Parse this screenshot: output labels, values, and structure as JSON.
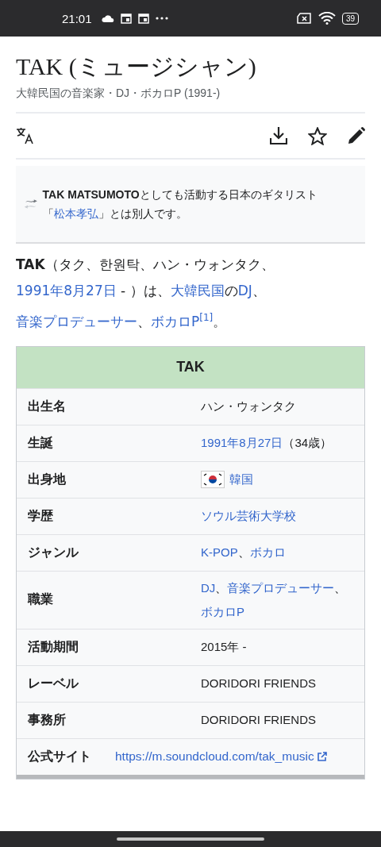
{
  "status_bar": {
    "time": "21:01",
    "battery": "39"
  },
  "header": {
    "title": "TAK (ミュージシャン)",
    "subtitle": "大韓民国の音楽家・DJ・ボカロP (1991-)"
  },
  "hatnote": [
    {
      "kind": "bold",
      "text": "TAK MATSUMOTO"
    },
    {
      "kind": "text",
      "text": "としても活動する日本のギタリスト「"
    },
    {
      "kind": "link",
      "text": "松本孝弘"
    },
    {
      "kind": "text",
      "text": "」とは別人です。"
    }
  ],
  "intro": [
    {
      "kind": "bold",
      "text": "TAK"
    },
    {
      "kind": "text",
      "text": "（タク、한원탁、ハン・ウォンタク、"
    },
    {
      "kind": "link",
      "text": "1991年8月27日"
    },
    {
      "kind": "text",
      "text": " - ）は、"
    },
    {
      "kind": "link",
      "text": "大韓民国"
    },
    {
      "kind": "text",
      "text": "の"
    },
    {
      "kind": "link",
      "text": "DJ"
    },
    {
      "kind": "text",
      "text": "、"
    },
    {
      "kind": "link",
      "text": "音楽プロデューサー"
    },
    {
      "kind": "text",
      "text": "、"
    },
    {
      "kind": "link",
      "text": "ボカロP"
    },
    {
      "kind": "sup",
      "text": "[1]"
    },
    {
      "kind": "text",
      "text": "。"
    }
  ],
  "infobox": {
    "title": "TAK",
    "rows": [
      {
        "label": "出生名",
        "value": [
          {
            "kind": "text",
            "text": "ハン・ウォンタク"
          }
        ]
      },
      {
        "label": "生誕",
        "value": [
          {
            "kind": "link",
            "text": "1991年8月27日"
          },
          {
            "kind": "text",
            "text": "（34歳）"
          }
        ]
      },
      {
        "label": "出身地",
        "value": [
          {
            "kind": "flag"
          },
          {
            "kind": "link",
            "text": "韓国"
          }
        ]
      },
      {
        "label": "学歴",
        "value": [
          {
            "kind": "link",
            "text": "ソウル芸術大学校"
          }
        ]
      },
      {
        "label": "ジャンル",
        "value": [
          {
            "kind": "link",
            "text": "K-POP"
          },
          {
            "kind": "text",
            "text": "、"
          },
          {
            "kind": "link",
            "text": "ボカロ"
          }
        ]
      },
      {
        "label": "職業",
        "value": [
          {
            "kind": "link",
            "text": "DJ"
          },
          {
            "kind": "text",
            "text": "、"
          },
          {
            "kind": "link",
            "text": "音楽プロデューサー"
          },
          {
            "kind": "text",
            "text": "、"
          },
          {
            "kind": "link",
            "text": "ボカロP"
          }
        ]
      },
      {
        "label": "活動期間",
        "value": [
          {
            "kind": "text",
            "text": "2015年 -"
          }
        ]
      },
      {
        "label": "レーベル",
        "value": [
          {
            "kind": "text",
            "text": "DORIDORI FRIENDS"
          }
        ]
      },
      {
        "label": "事務所",
        "value": [
          {
            "kind": "text",
            "text": "DORIDORI FRIENDS"
          }
        ]
      },
      {
        "label": "公式サイト",
        "value": [
          {
            "kind": "external",
            "text": "https://m.soundcloud.com/tak_music"
          }
        ]
      }
    ]
  }
}
